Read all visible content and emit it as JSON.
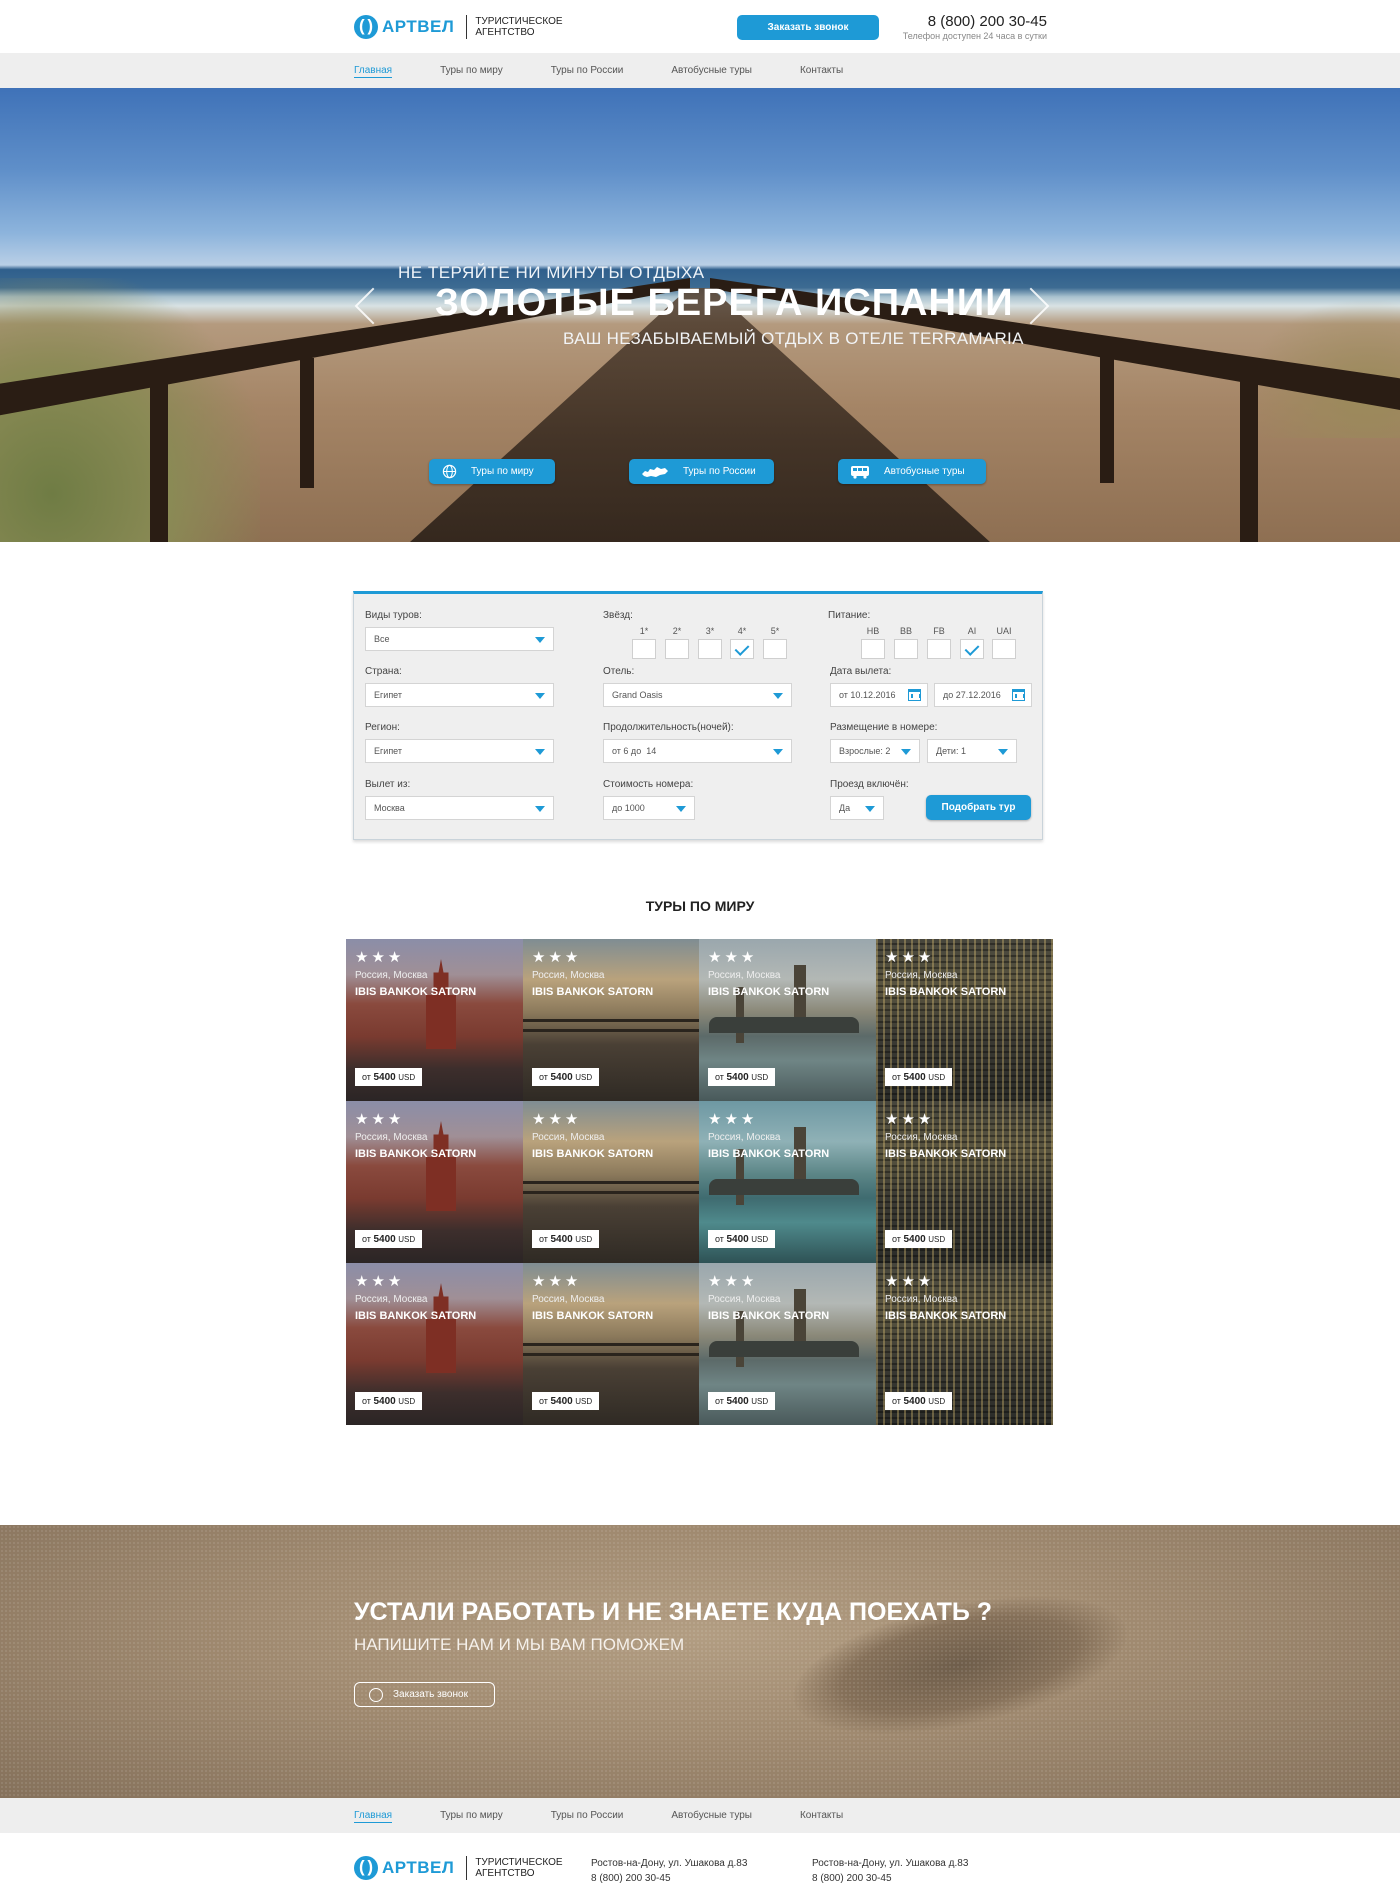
{
  "header": {
    "brand": "АРТВЕЛ",
    "brand_sub": "ТУРИСТИЧЕСКОЕ АГЕНТСТВО",
    "callback_label": "Заказать звонок",
    "phone": "8 (800) 200 30-45",
    "phone_note": "Телефон доступен 24 часа в сутки"
  },
  "nav": {
    "items": [
      {
        "label": "Главная",
        "active": true
      },
      {
        "label": "Туры по миру"
      },
      {
        "label": "Туры по России"
      },
      {
        "label": "Автобусные туры"
      },
      {
        "label": "Контакты"
      }
    ]
  },
  "hero": {
    "subtitle": "НЕ ТЕРЯЙТЕ НИ МИНУТЫ ОТДЫХА",
    "title": "ЗОЛОТЫЕ БЕРЕГА ИСПАНИИ",
    "tagline": "ВАШ НЕЗАБЫВАЕМЫЙ ОТДЫХ В ОТЕЛЕ TERRAMARIA",
    "buttons": [
      {
        "label": "Туры по миру",
        "icon": "globe-icon"
      },
      {
        "label": "Туры по России",
        "icon": "russia-map-icon"
      },
      {
        "label": "Автобусные туры",
        "icon": "bus-icon"
      }
    ]
  },
  "search": {
    "tour_type": {
      "label": "Виды туров:",
      "value": "Все"
    },
    "country": {
      "label": "Страна:",
      "value": "Египет"
    },
    "region": {
      "label": "Регион:",
      "value": "Египет"
    },
    "departure": {
      "label": "Вылет из:",
      "value": "Москва"
    },
    "stars": {
      "label": "Звёзд:",
      "options": [
        "1*",
        "2*",
        "3*",
        "4*",
        "5*"
      ],
      "checked": "4*"
    },
    "hotel": {
      "label": "Отель:",
      "value": "Grand Oasis"
    },
    "duration": {
      "label": "Продолжительность(ночей):",
      "value": "от 6 до  14"
    },
    "room_cost": {
      "label": "Стоимость номера:",
      "value": "до 1000"
    },
    "meals": {
      "label": "Питание:",
      "options": [
        "HB",
        "BB",
        "FB",
        "AI",
        "UAI"
      ],
      "checked": "AI"
    },
    "dates": {
      "label": "Дата вылета:",
      "from": "от 10.12.2016",
      "to": "до 27.12.2016"
    },
    "accommodation": {
      "label": "Размещение в номере:",
      "adults": "Взрослые: 2",
      "children": "Дети: 1"
    },
    "transfer": {
      "label": "Проезд включён:",
      "value": "Да"
    },
    "submit_label": "Подобрать тур"
  },
  "tours": {
    "title": "ТУРЫ ПО МИРУ",
    "cards": [
      {
        "stars": "★★★",
        "location": "Россия, Москва",
        "hotel": "IBIS BANKOK SATORN",
        "price_prefix": "от",
        "price": "5400",
        "currency": "USD",
        "scene": "moscow"
      },
      {
        "stars": "★★★",
        "location": "Россия, Москва",
        "hotel": "IBIS BANKOK SATORN",
        "price_prefix": "от",
        "price": "5400",
        "currency": "USD",
        "scene": "pier"
      },
      {
        "stars": "★★★",
        "location": "Россия, Москва",
        "hotel": "IBIS BANKOK SATORN",
        "price_prefix": "от",
        "price": "5400",
        "currency": "USD",
        "scene": "london"
      },
      {
        "stars": "★★★",
        "location": "Россия, Москва",
        "hotel": "IBIS BANKOK SATORN",
        "price_prefix": "от",
        "price": "5400",
        "currency": "USD",
        "scene": "city"
      },
      {
        "stars": "★★★",
        "location": "Россия, Москва",
        "hotel": "IBIS BANKOK SATORN",
        "price_prefix": "от",
        "price": "5400",
        "currency": "USD",
        "scene": "moscow"
      },
      {
        "stars": "★★★",
        "location": "Россия, Москва",
        "hotel": "IBIS BANKOK SATORN",
        "price_prefix": "от",
        "price": "5400",
        "currency": "USD",
        "scene": "pier"
      },
      {
        "stars": "★★★",
        "location": "Россия, Москва",
        "hotel": "IBIS BANKOK SATORN",
        "price_prefix": "от",
        "price": "5400",
        "currency": "USD",
        "scene": "london-teal"
      },
      {
        "stars": "★★★",
        "location": "Россия, Москва",
        "hotel": "IBIS BANKOK SATORN",
        "price_prefix": "от",
        "price": "5400",
        "currency": "USD",
        "scene": "city"
      },
      {
        "stars": "★★★",
        "location": "Россия, Москва",
        "hotel": "IBIS BANKOK SATORN",
        "price_prefix": "от",
        "price": "5400",
        "currency": "USD",
        "scene": "moscow"
      },
      {
        "stars": "★★★",
        "location": "Россия, Москва",
        "hotel": "IBIS BANKOK SATORN",
        "price_prefix": "от",
        "price": "5400",
        "currency": "USD",
        "scene": "pier"
      },
      {
        "stars": "★★★",
        "location": "Россия, Москва",
        "hotel": "IBIS BANKOK SATORN",
        "price_prefix": "от",
        "price": "5400",
        "currency": "USD",
        "scene": "london"
      },
      {
        "stars": "★★★",
        "location": "Россия, Москва",
        "hotel": "IBIS BANKOK SATORN",
        "price_prefix": "от",
        "price": "5400",
        "currency": "USD",
        "scene": "city"
      }
    ]
  },
  "cta": {
    "title": "УСТАЛИ РАБОТАТЬ И НЕ ЗНАЕТЕ КУДА ПОЕХАТЬ ?",
    "subtitle": "НАПИШИТЕ НАМ И МЫ ВАМ ПОМОЖЕМ",
    "button_label": "Заказать звонок",
    "button_icon": "phone-icon"
  },
  "footer": {
    "brand": "АРТВЕЛ",
    "brand_sub": "ТУРИСТИЧЕСКОЕ АГЕНТСТВО",
    "contacts": [
      {
        "address": "Ростов-на-Дону, ул. Ушакова д.83",
        "phone": "8 (800) 200 30-45"
      },
      {
        "address": "Ростов-на-Дону, ул. Ушакова д.83",
        "phone": "8 (800) 200 30-45"
      }
    ]
  },
  "colors": {
    "accent": "#1e9ad6",
    "nav_bg": "#eeeeee"
  }
}
